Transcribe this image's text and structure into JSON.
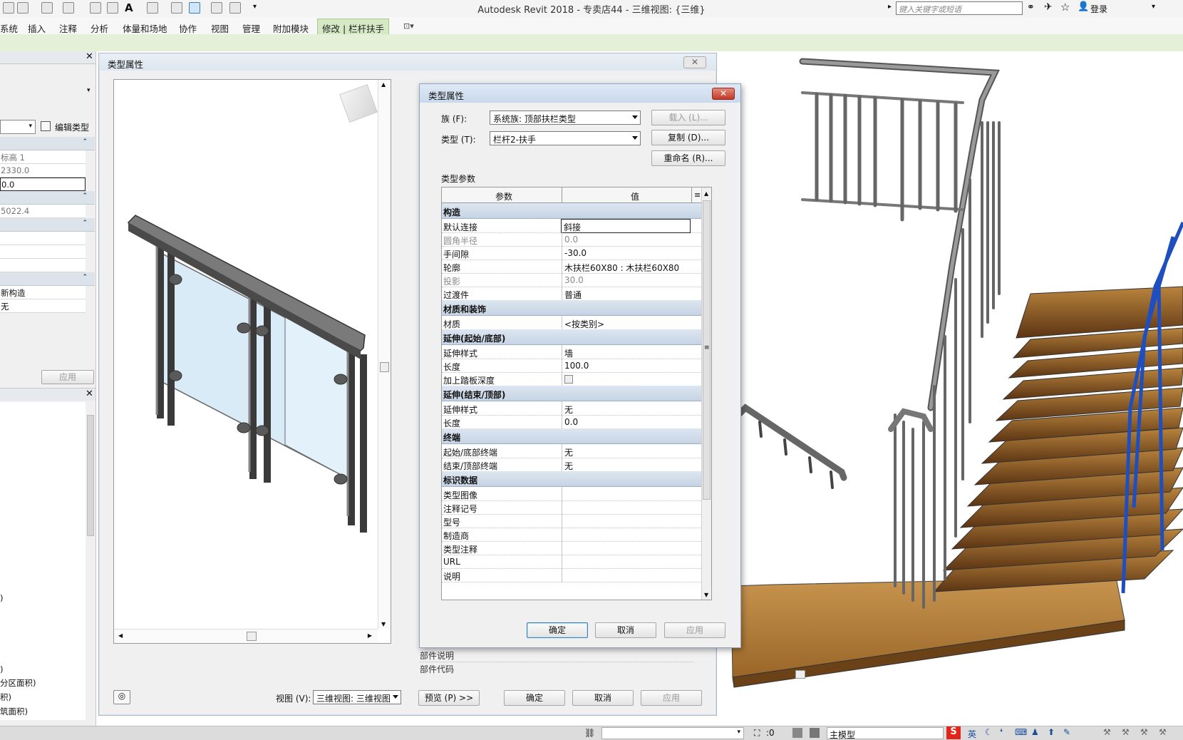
{
  "app": {
    "title": "Autodesk Revit 2018 -     专卖店44 - 三维视图: {三维}",
    "search_placeholder": "键入关键字或短语",
    "login": "登录"
  },
  "menu": [
    "系统",
    "插入",
    "注释",
    "分析",
    "体量和场地",
    "协作",
    "视图",
    "管理",
    "附加模块"
  ],
  "menu_active": "修改 | 栏杆扶手",
  "left_panel": {
    "edit_type": "编辑类型",
    "rows": [
      "标高 1",
      "2330.0",
      "0.0",
      "5022.4",
      "新构造",
      "无"
    ],
    "apply": "应用",
    "browser_items": [
      ")",
      ")",
      "分区面积)",
      "积)",
      "筑面积)"
    ]
  },
  "outer_dialog": {
    "title": "类型属性",
    "view_label": "视图 (V):",
    "view_value": "三维视图: 三维视图",
    "preview_btn": "预览 (P) >>",
    "ok": "确定",
    "cancel": "取消",
    "apply": "应用",
    "behind_rows": [
      "部件说明",
      "部件代码"
    ]
  },
  "inner_dialog": {
    "title": "类型属性",
    "family_label": "族 (F):",
    "family_value": "系统族: 顶部扶栏类型",
    "type_label": "类型 (T):",
    "type_value": "栏杆2-扶手",
    "load_btn": "载入 (L)...",
    "duplicate_btn": "复制 (D)...",
    "rename_btn": "重命名 (R)...",
    "type_params_label": "类型参数",
    "col_param": "参数",
    "col_value": "值",
    "sections": [
      {
        "name": "构造",
        "rows": [
          {
            "k": "默认连接",
            "v": "斜接",
            "edit": true
          },
          {
            "k": "圆角半径",
            "v": "0.0",
            "grey": true
          },
          {
            "k": "手间隙",
            "v": "-30.0"
          },
          {
            "k": "轮廓",
            "v": "木扶栏60X80 : 木扶栏60X80"
          },
          {
            "k": "投影",
            "v": "30.0",
            "grey": true
          },
          {
            "k": "过渡件",
            "v": "普通"
          }
        ]
      },
      {
        "name": "材质和装饰",
        "rows": [
          {
            "k": "材质",
            "v": "<按类别>"
          }
        ]
      },
      {
        "name": "延伸(起始/底部)",
        "rows": [
          {
            "k": "延伸样式",
            "v": "墙"
          },
          {
            "k": "长度",
            "v": "100.0"
          },
          {
            "k": "加上踏板深度",
            "v": "",
            "check": true
          }
        ]
      },
      {
        "name": "延伸(结束/顶部)",
        "rows": [
          {
            "k": "延伸样式",
            "v": "无"
          },
          {
            "k": "长度",
            "v": "0.0"
          }
        ]
      },
      {
        "name": "终端",
        "rows": [
          {
            "k": "起始/底部终端",
            "v": "无"
          },
          {
            "k": "结束/顶部终端",
            "v": "无"
          }
        ]
      },
      {
        "name": "标识数据",
        "rows": [
          {
            "k": "类型图像",
            "v": ""
          },
          {
            "k": "注释记号",
            "v": ""
          },
          {
            "k": "型号",
            "v": ""
          },
          {
            "k": "制造商",
            "v": ""
          },
          {
            "k": "类型注释",
            "v": ""
          },
          {
            "k": "URL",
            "v": ""
          },
          {
            "k": "说明",
            "v": ""
          }
        ]
      }
    ],
    "ok": "确定",
    "cancel": "取消",
    "apply": "应用"
  },
  "status": {
    "value": ":0",
    "model": "主模型",
    "ime": "英"
  },
  "colors": {
    "ribbon_active": "#d4e9c4",
    "section_header": "#c7d4e5",
    "wood": "#b07a36",
    "selection_blue": "#1f4fbf"
  }
}
